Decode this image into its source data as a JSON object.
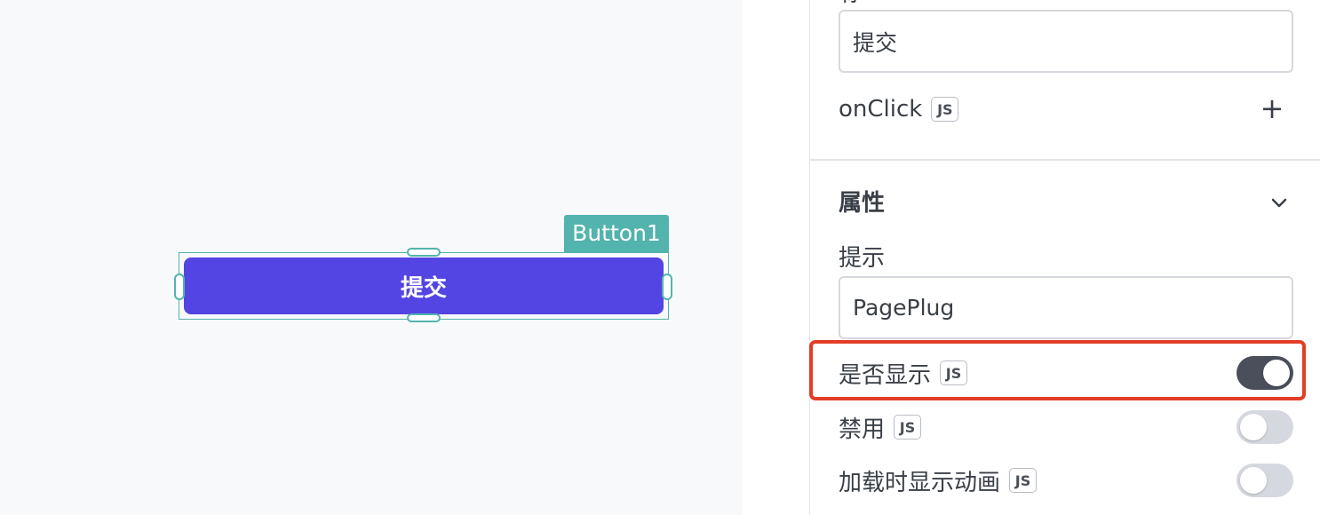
{
  "canvas": {
    "widget_tag": "Button1",
    "button_label": "提交"
  },
  "panel": {
    "top_label_partial": "标",
    "label_input_value": "提交",
    "onclick_label": "onClick",
    "js_badge": "JS",
    "section_title": "属性",
    "tooltip_label": "提示",
    "tooltip_value": "PagePlug",
    "visible_label": "是否显示",
    "visible_on": true,
    "disabled_label": "禁用",
    "disabled_on": false,
    "loading_label": "加载时显示动画",
    "loading_on": false
  },
  "colors": {
    "accent": "#5345e3",
    "selection": "#53b3ad",
    "highlight": "#e33d26",
    "toggle_on": "#4a4f5b",
    "toggle_off": "#d5d8de"
  }
}
